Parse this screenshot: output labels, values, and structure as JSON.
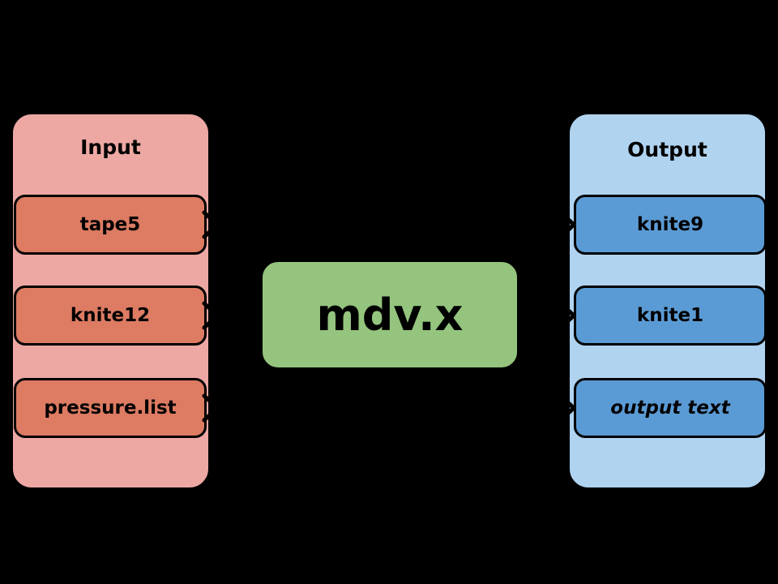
{
  "diagram": {
    "background_color": "#000000",
    "input_group": {
      "title": "Input",
      "fill_color": "#eda8a4",
      "items": [
        {
          "label": "tape5",
          "style": "normal"
        },
        {
          "label": "knite12",
          "style": "normal"
        },
        {
          "label": "pressure.list",
          "style": "normal"
        }
      ],
      "item_fill_color": "#dd7b63"
    },
    "process": {
      "label": "mdv.x",
      "fill_color": "#94c47d"
    },
    "output_group": {
      "title": "Output",
      "fill_color": "#b0d3f0",
      "items": [
        {
          "label": "knite9",
          "style": "normal"
        },
        {
          "label": "knite1",
          "style": "normal"
        },
        {
          "label": "output text",
          "style": "italic"
        }
      ],
      "item_fill_color": "#5b9bd5"
    }
  }
}
